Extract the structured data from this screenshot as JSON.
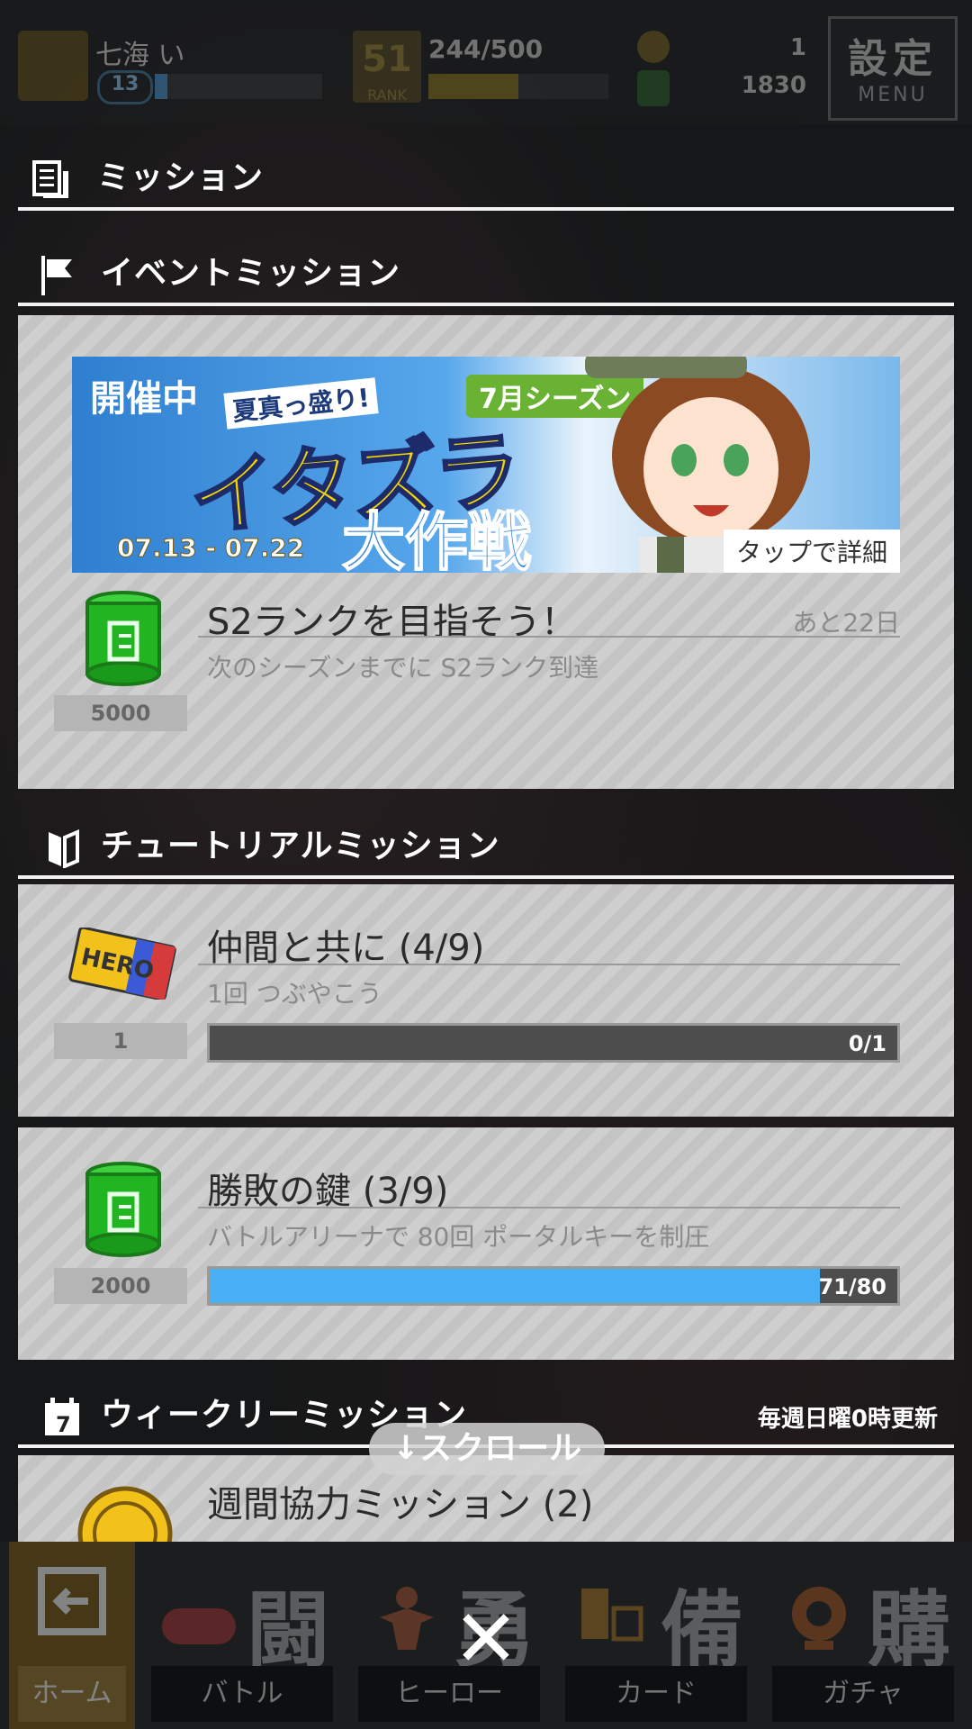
{
  "status": {
    "player_name": "七海 い",
    "level": "13",
    "rank_number": "51",
    "rank_label": "RANK",
    "exp": "244/500",
    "coin_count": "1",
    "gem_count": "1830",
    "menu_kanji": "設定",
    "menu_label": "MENU"
  },
  "page_title": "ミッション",
  "event_section": {
    "title": "イベントミッション",
    "banner": {
      "holding": "開催中",
      "summer": "夏真っ盛り!",
      "season": "7月シーズン",
      "title_line1": "イタズラ",
      "title_line2": "大作戦",
      "dates": "07.13 - 07.22",
      "tap_text": "タップで詳細"
    },
    "mission": {
      "title": "S2ランクを目指そう！",
      "remaining": "あと22日",
      "description": "次のシーズンまでに S2ランク到達",
      "reward_count": "5000"
    }
  },
  "tutorial_section": {
    "title": "チュートリアルミッション",
    "missions": [
      {
        "title": "仲間と共に (4/9)",
        "description": "1回 つぶやこう",
        "reward_count": "1",
        "progress_text": "0/1",
        "progress": 0
      },
      {
        "title": "勝敗の鍵 (3/9)",
        "description": "バトルアリーナで 80回 ポータルキーを制圧",
        "reward_count": "2000",
        "progress_text": "71/80",
        "progress": 0.8875
      }
    ]
  },
  "weekly_section": {
    "title": "ウィークリーミッション",
    "note": "毎週日曜0時更新",
    "mission_title": "週間協力ミッション (2)"
  },
  "scroll_hint": "↓スクロール",
  "bottom_nav": [
    {
      "kanji": "",
      "label": "ホーム"
    },
    {
      "kanji": "闘",
      "label": "バトル"
    },
    {
      "kanji": "勇",
      "label": "ヒーロー"
    },
    {
      "kanji": "備",
      "label": "カード"
    },
    {
      "kanji": "購",
      "label": "ガチャ"
    }
  ],
  "close_glyph": "✕",
  "colors": {
    "progress_fill": "#4ab0f5",
    "banner_accent": "#f5d700",
    "season_badge": "#6ab233"
  }
}
